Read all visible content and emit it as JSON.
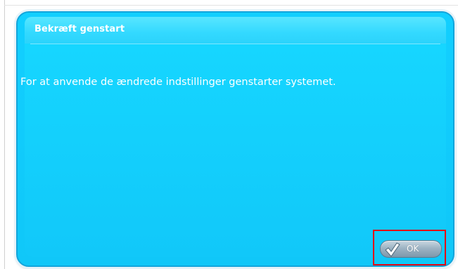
{
  "dialog": {
    "title": "Bekræft genstart",
    "message": "For at anvende de ændrede indstillinger genstarter systemet.",
    "ok_label": "OK",
    "ok_icon": "checkmark-icon"
  },
  "colors": {
    "dialog_fill": "#12cfff",
    "dialog_border": "#13a5db",
    "header_fill": "#45e0ff",
    "button_fill": "#9db3c3",
    "highlight": "#e30613",
    "text": "#ffffff"
  }
}
